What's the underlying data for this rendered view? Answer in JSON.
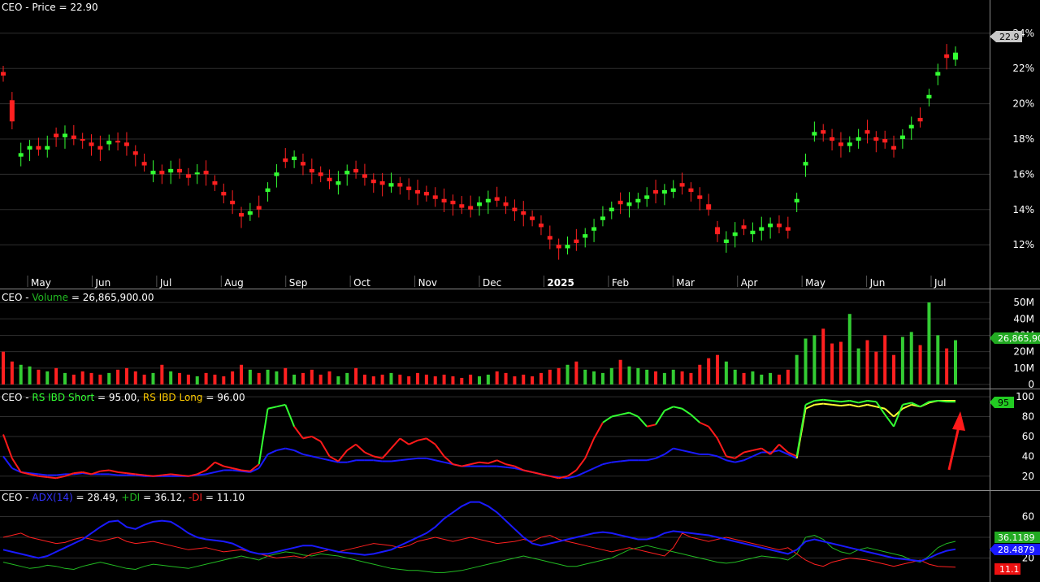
{
  "chart_data": [
    {
      "type": "candlestick",
      "title_ticker": "CEO",
      "title_label": "Price = 22.90",
      "last_value_tag": "22.9",
      "y_ticks": [
        "24%",
        "22%",
        "20%",
        "18%",
        "16%",
        "14%",
        "12%"
      ],
      "ylim": [
        10.3,
        25.7
      ],
      "x_months": [
        "May",
        "Jun",
        "Jul",
        "Aug",
        "Sep",
        "Oct",
        "Nov",
        "Dec",
        "2025",
        "Feb",
        "Mar",
        "Apr",
        "May",
        "Jun",
        "Jul"
      ],
      "closes": [
        21.6,
        19.0,
        17.2,
        17.6,
        17.4,
        17.6,
        18.1,
        18.3,
        18.0,
        17.9,
        17.6,
        17.4,
        17.9,
        17.8,
        17.6,
        17.1,
        16.5,
        16.2,
        16.0,
        16.3,
        16.1,
        15.8,
        16.1,
        16.0,
        15.4,
        14.8,
        14.3,
        13.6,
        13.9,
        14.0,
        15.2,
        16.1,
        16.7,
        17.0,
        16.5,
        16.1,
        15.9,
        15.6,
        15.6,
        16.2,
        16.1,
        15.8,
        15.5,
        15.4,
        15.5,
        15.3,
        15.1,
        14.9,
        14.8,
        14.6,
        14.4,
        14.3,
        14.1,
        14.0,
        14.4,
        14.6,
        14.5,
        14.2,
        13.9,
        13.7,
        13.4,
        13.0,
        12.3,
        11.8,
        12.0,
        12.1,
        12.6,
        13.0,
        13.6,
        14.1,
        14.3,
        14.4,
        14.6,
        14.8,
        14.9,
        15.1,
        15.2,
        15.3,
        15.0,
        14.6,
        14.0,
        12.6,
        12.3,
        12.7,
        12.9,
        12.8,
        13.0,
        13.2,
        13.0,
        12.8,
        14.6,
        16.7,
        18.4,
        18.3,
        17.9,
        17.6,
        17.8,
        18.1,
        18.3,
        17.9,
        17.8,
        17.4,
        18.2,
        18.8,
        19.0,
        20.5,
        21.8,
        22.6,
        22.9
      ],
      "opens": [
        21.8,
        20.2,
        17.0,
        17.4,
        17.6,
        17.4,
        18.3,
        18.1,
        18.2,
        18.0,
        17.8,
        17.6,
        17.7,
        17.9,
        17.8,
        17.3,
        16.7,
        16.0,
        16.2,
        16.1,
        16.3,
        16.0,
        16.0,
        16.2,
        15.6,
        15.0,
        14.5,
        13.8,
        13.7,
        14.2,
        15.0,
        15.9,
        16.9,
        16.8,
        16.7,
        16.3,
        16.1,
        15.8,
        15.4,
        16.0,
        16.3,
        16.0,
        15.7,
        15.6,
        15.3,
        15.5,
        15.3,
        15.1,
        15.0,
        14.8,
        14.6,
        14.5,
        14.3,
        14.2,
        14.2,
        14.4,
        14.7,
        14.4,
        14.1,
        13.9,
        13.6,
        13.2,
        12.5,
        12.0,
        11.8,
        12.3,
        12.4,
        12.8,
        13.4,
        13.9,
        14.5,
        14.2,
        14.4,
        14.6,
        15.1,
        14.9,
        15.0,
        15.5,
        15.2,
        14.8,
        14.3,
        13.0,
        12.1,
        12.5,
        13.1,
        12.6,
        12.8,
        13.0,
        13.2,
        13.0,
        14.4,
        16.5,
        18.2,
        18.5,
        18.1,
        17.8,
        17.6,
        17.9,
        18.5,
        18.1,
        18.0,
        17.6,
        18.0,
        18.6,
        19.2,
        20.3,
        21.6,
        22.8,
        22.5
      ],
      "series_colors": {
        "up": "#33ff33",
        "down": "#ff2020"
      }
    },
    {
      "type": "bar",
      "title_ticker": "CEO",
      "title_label": "Volume",
      "title_value": "= 26,865,900.00",
      "last_value_tag": "26,865,90",
      "y_ticks": [
        "50M",
        "40M",
        "30M",
        "20M",
        "10M",
        "0"
      ],
      "ylim": [
        0,
        55
      ],
      "values_m": [
        20,
        14,
        12,
        11,
        9,
        8,
        10,
        7,
        6,
        8,
        7,
        6,
        7,
        9,
        10,
        8,
        6,
        7,
        12,
        8,
        7,
        6,
        5,
        7,
        6,
        5,
        8,
        12,
        9,
        7,
        9,
        8,
        10,
        6,
        7,
        9,
        6,
        8,
        5,
        7,
        10,
        6,
        5,
        6,
        7,
        6,
        5,
        7,
        6,
        5,
        6,
        5,
        4,
        6,
        5,
        6,
        8,
        7,
        5,
        6,
        5,
        7,
        9,
        10,
        12,
        14,
        9,
        8,
        7,
        10,
        15,
        11,
        10,
        9,
        8,
        7,
        9,
        8,
        7,
        12,
        16,
        18,
        14,
        9,
        7,
        8,
        6,
        7,
        6,
        9,
        18,
        28,
        30,
        34,
        25,
        26,
        43,
        22,
        27,
        20,
        30,
        18,
        29,
        32,
        24,
        50,
        30,
        22,
        27
      ],
      "series_colors": {
        "up": "#33cc33",
        "down": "#ff2020"
      }
    },
    {
      "type": "line",
      "title_ticker": "CEO",
      "series_labels": {
        "short": "RS IBD Short",
        "short_value": "= 95.00,",
        "long": "RS IBD Long",
        "long_value": "= 96.00"
      },
      "last_value_tag": "95",
      "y_ticks": [
        "100",
        "80",
        "60",
        "40",
        "20"
      ],
      "ylim": [
        10,
        105
      ],
      "short": [
        62,
        38,
        24,
        22,
        20,
        19,
        18,
        20,
        23,
        24,
        22,
        25,
        26,
        24,
        23,
        22,
        21,
        20,
        21,
        22,
        21,
        20,
        22,
        26,
        34,
        30,
        28,
        26,
        25,
        32,
        88,
        90,
        92,
        70,
        58,
        60,
        55,
        40,
        35,
        46,
        52,
        44,
        40,
        38,
        48,
        58,
        52,
        56,
        58,
        52,
        40,
        32,
        30,
        32,
        34,
        33,
        36,
        32,
        30,
        26,
        24,
        22,
        20,
        18,
        20,
        26,
        38,
        58,
        74,
        80,
        82,
        84,
        80,
        70,
        72,
        86,
        90,
        88,
        82,
        74,
        70,
        58,
        40,
        38,
        44,
        46,
        48,
        42,
        52,
        44,
        40,
        92,
        96,
        97,
        96,
        95,
        96,
        94,
        96,
        95,
        82,
        70,
        92,
        94,
        90,
        95,
        96,
        95,
        95
      ],
      "long": [
        40,
        28,
        24,
        23,
        22,
        21,
        21,
        22,
        22,
        23,
        22,
        22,
        22,
        21,
        21,
        21,
        20,
        20,
        20,
        20,
        20,
        20,
        21,
        22,
        24,
        26,
        26,
        25,
        24,
        28,
        42,
        46,
        48,
        46,
        42,
        40,
        38,
        36,
        34,
        34,
        36,
        36,
        36,
        35,
        35,
        36,
        37,
        38,
        38,
        36,
        34,
        32,
        30,
        30,
        30,
        30,
        30,
        29,
        28,
        26,
        24,
        22,
        20,
        19,
        18,
        20,
        24,
        28,
        32,
        34,
        35,
        36,
        36,
        36,
        38,
        42,
        48,
        46,
        44,
        42,
        42,
        40,
        36,
        34,
        36,
        40,
        44,
        44,
        46,
        42,
        38,
        88,
        92,
        93,
        92,
        91,
        92,
        90,
        92,
        90,
        88,
        80,
        88,
        92,
        90,
        94,
        96,
        96,
        96
      ],
      "series_colors": {
        "short_low": "#ff1a1a",
        "short_high": "#33ff33",
        "long_low": "#1a1aff",
        "long_high": "#ffff33"
      },
      "annotation": "red arrow pointing to latest value"
    },
    {
      "type": "line",
      "title_ticker": "CEO",
      "series_labels": {
        "adx": "ADX(14)",
        "adx_value": "= 28.49,",
        "pdi": "+DI",
        "pdi_value": "= 36.12,",
        "mdi": "-DI",
        "mdi_value": "= 11.10"
      },
      "tags": {
        "pdi": "36.1189",
        "adx": "28.4879",
        "mdi": "11.1"
      },
      "y_ticks": [
        "60",
        "40",
        "20"
      ],
      "ylim": [
        0,
        80
      ],
      "adx": [
        28,
        26,
        24,
        22,
        20,
        22,
        26,
        30,
        34,
        38,
        44,
        50,
        55,
        56,
        50,
        48,
        52,
        55,
        56,
        55,
        50,
        44,
        40,
        38,
        37,
        36,
        34,
        30,
        26,
        24,
        24,
        26,
        28,
        30,
        32,
        32,
        30,
        28,
        26,
        25,
        24,
        23,
        24,
        26,
        28,
        32,
        36,
        40,
        44,
        50,
        58,
        64,
        70,
        74,
        74,
        70,
        64,
        56,
        48,
        40,
        34,
        32,
        34,
        36,
        38,
        40,
        42,
        44,
        45,
        44,
        42,
        40,
        38,
        38,
        40,
        44,
        46,
        45,
        44,
        43,
        42,
        40,
        38,
        36,
        34,
        32,
        30,
        28,
        26,
        24,
        28,
        36,
        38,
        36,
        34,
        32,
        30,
        28,
        26,
        24,
        22,
        20,
        19,
        18,
        17,
        20,
        24,
        27,
        28.5
      ],
      "pdi": [
        16,
        14,
        12,
        10,
        11,
        13,
        12,
        10,
        9,
        12,
        14,
        16,
        14,
        12,
        10,
        9,
        12,
        14,
        13,
        12,
        11,
        10,
        12,
        14,
        16,
        18,
        20,
        22,
        20,
        18,
        22,
        24,
        26,
        25,
        23,
        22,
        24,
        23,
        22,
        20,
        18,
        16,
        14,
        12,
        10,
        9,
        8,
        8,
        7,
        6,
        6,
        7,
        8,
        10,
        12,
        14,
        16,
        18,
        20,
        22,
        20,
        18,
        16,
        14,
        12,
        12,
        14,
        16,
        18,
        20,
        24,
        28,
        30,
        32,
        30,
        28,
        26,
        24,
        22,
        20,
        18,
        16,
        15,
        16,
        18,
        20,
        22,
        21,
        20,
        18,
        24,
        40,
        42,
        38,
        30,
        26,
        24,
        28,
        30,
        28,
        26,
        24,
        22,
        18,
        16,
        22,
        30,
        34,
        36.1
      ],
      "mdi": [
        40,
        42,
        44,
        40,
        38,
        36,
        34,
        35,
        38,
        40,
        38,
        36,
        38,
        40,
        36,
        34,
        35,
        36,
        34,
        32,
        30,
        28,
        29,
        30,
        28,
        26,
        27,
        28,
        26,
        24,
        22,
        20,
        21,
        22,
        20,
        24,
        26,
        28,
        26,
        28,
        30,
        32,
        34,
        33,
        32,
        30,
        32,
        36,
        38,
        40,
        38,
        36,
        38,
        40,
        38,
        36,
        34,
        35,
        36,
        38,
        36,
        40,
        42,
        38,
        36,
        34,
        32,
        30,
        28,
        26,
        28,
        30,
        28,
        26,
        24,
        22,
        30,
        44,
        40,
        38,
        36,
        38,
        40,
        38,
        36,
        34,
        32,
        30,
        28,
        30,
        24,
        18,
        14,
        12,
        16,
        18,
        20,
        19,
        18,
        16,
        14,
        12,
        14,
        16,
        18,
        14,
        12,
        11.5,
        11.1
      ],
      "series_colors": {
        "adx": "#1a1aff",
        "pdi": "#22bb22",
        "mdi": "#ff2020"
      }
    }
  ]
}
